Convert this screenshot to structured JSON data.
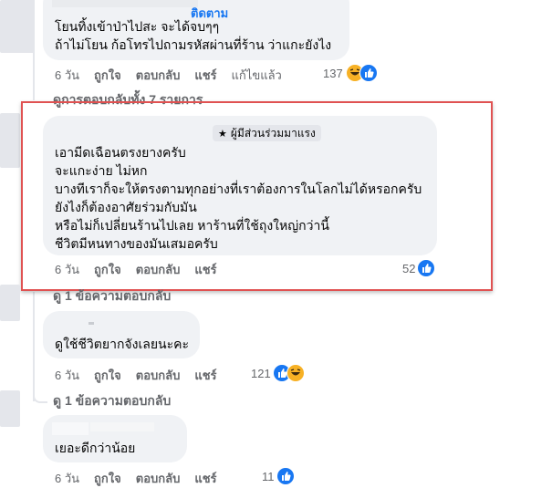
{
  "comment1": {
    "follow_label": "ติดตาม",
    "lines": [
      "โยนทิ้งเข้าป่าไปสะ จะได้จบๆๆ",
      "ถ้าไม่โยน ก้อโทรไปถามรหัสผ่านที่ร้าน ว่าแกะยังไง"
    ],
    "actions": {
      "time": "6 วัน",
      "like": "ถูกใจ",
      "reply": "ตอบกลับ",
      "share": "แชร์",
      "edited": "แก้ไขแล้ว"
    },
    "reaction_count": "137",
    "reactions": [
      "like-icon",
      "haha-icon"
    ]
  },
  "replies_all": "ดูการตอบกลับทั้ง 7 รายการ",
  "comment2": {
    "badge": "ผู้มีส่วนร่วมมาแรง",
    "lines": [
      "เอามีดเฉือนตรงยางครับ",
      "จะแกะง่าย ไม่หก",
      "บางทีเราก็จะให้ตรงตามทุกอย่างที่เราต้องการในโลกไม่ได้หรอกครับ",
      "ยังไงก็ต้องอาศัยร่วมกับมัน",
      "หรือไม่ก็เปลี่ยนร้านไปเลย หาร้านที่ใช้ถุงใหญ่กว่านี้",
      "ชีวิตมีหนทางของมันเสมอครับ"
    ],
    "actions": {
      "time": "6 วัน",
      "like": "ถูกใจ",
      "reply": "ตอบกลับ",
      "share": "แชร์"
    },
    "reaction_count": "52",
    "reactions": [
      "like-icon"
    ]
  },
  "replies_one_a": "ดู 1 ข้อความตอบกลับ",
  "comment3": {
    "lines": [
      "ดูใช้ชีวิตยากจังเลยนะคะ"
    ],
    "actions": {
      "time": "6 วัน",
      "like": "ถูกใจ",
      "reply": "ตอบกลับ",
      "share": "แชร์"
    },
    "reaction_count": "121",
    "reactions": [
      "like-icon",
      "haha-icon"
    ]
  },
  "replies_one_b": "ดู 1 ข้อความตอบกลับ",
  "comment4": {
    "lines": [
      "เยอะดีกว่าน้อย"
    ],
    "actions": {
      "time": "6 วัน",
      "like": "ถูกใจ",
      "reply": "ตอบกลับ",
      "share": "แชร์"
    },
    "reaction_count": "11",
    "reactions": [
      "like-icon"
    ]
  },
  "colors": {
    "highlight_border": "#e05252",
    "bubble": "#f0f2f5",
    "like": "#1877f2",
    "link": "#1877f2",
    "meta": "#65676b"
  }
}
